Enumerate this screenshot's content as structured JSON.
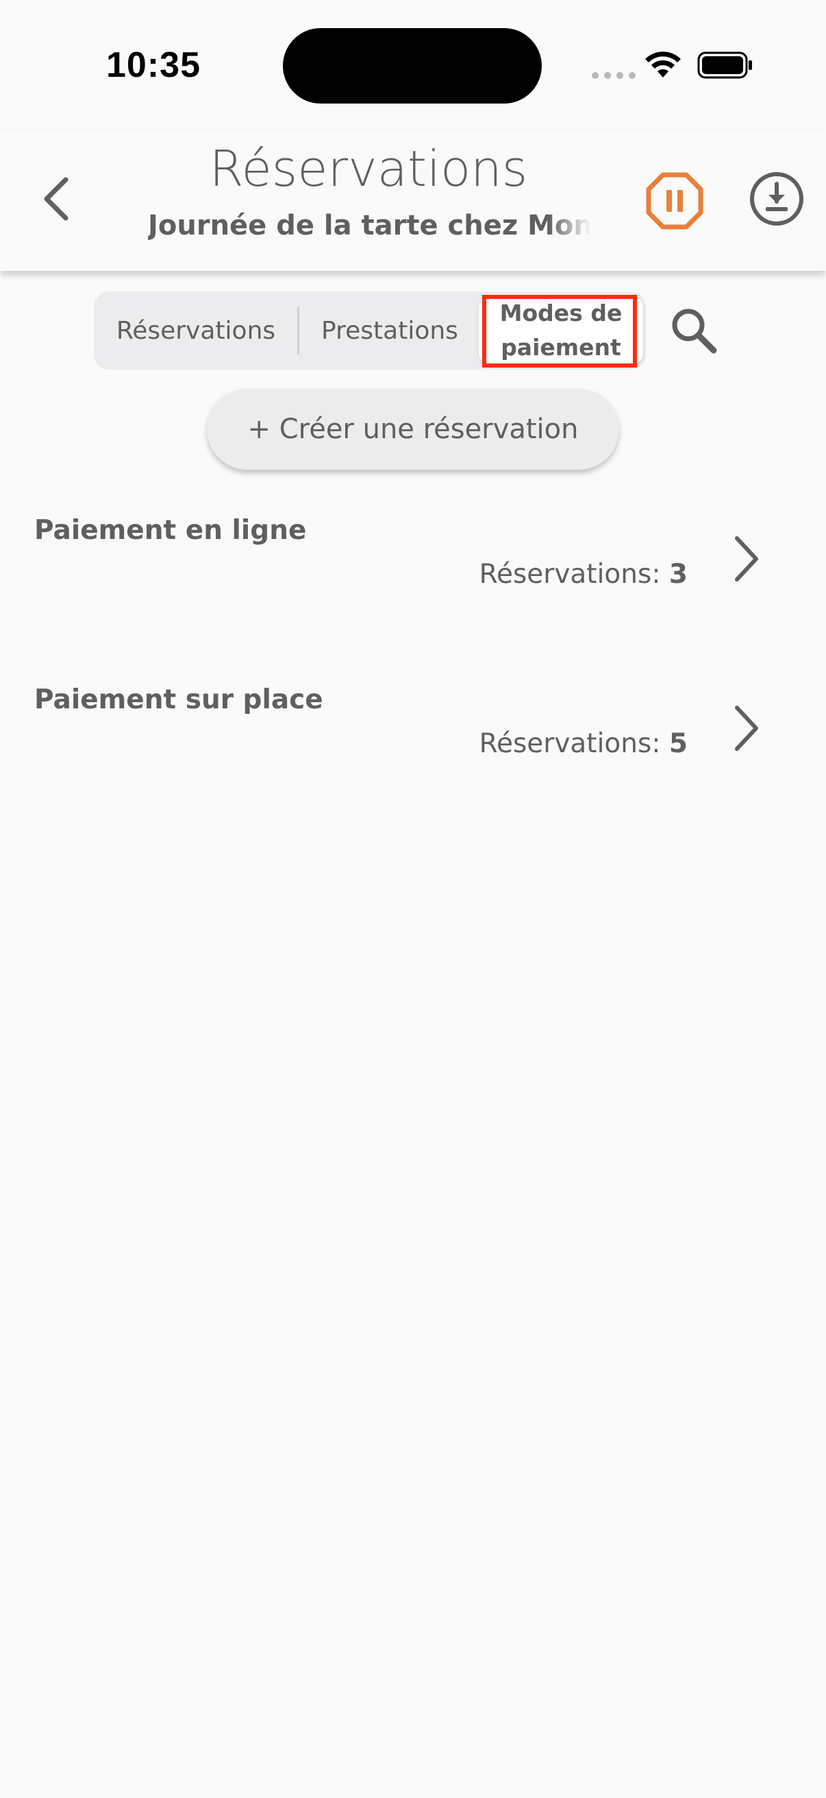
{
  "status_bar": {
    "time": "10:35"
  },
  "header": {
    "title": "Réservations",
    "subtitle": "Journée de la tarte chez Mon",
    "back_icon": "chevron-left-icon",
    "pause_icon": "pause-octagon-icon",
    "download_icon": "download-circle-icon",
    "accent_color": "#e8803a"
  },
  "tabs": [
    {
      "label": "Réservations",
      "selected": false
    },
    {
      "label": "Prestations",
      "selected": false
    },
    {
      "label_line1": "Modes de",
      "label_line2": "paiement",
      "selected": true
    }
  ],
  "search_icon": "search-icon",
  "create_button": {
    "label": "+ Créer une réservation"
  },
  "payment_modes": [
    {
      "title": "Paiement en ligne",
      "count_label": "Réservations:",
      "count": "3"
    },
    {
      "title": "Paiement sur place",
      "count_label": "Réservations:",
      "count": "5"
    }
  ],
  "colors": {
    "background": "#fafafa",
    "text": "#5f5f5f",
    "highlight": "#ff2a12"
  }
}
